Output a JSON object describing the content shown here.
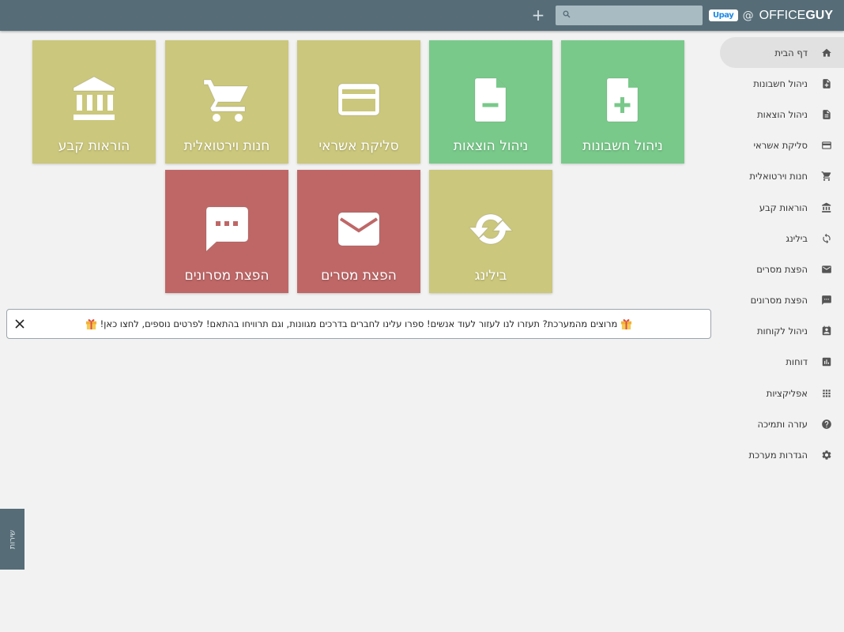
{
  "header": {
    "brand_logo_text": "Upay",
    "brand_at": "@",
    "brand_name_light": "OFFICE",
    "brand_name_bold": "GUY",
    "plus_label": "+",
    "search_placeholder": ""
  },
  "sidebar": {
    "items": [
      {
        "label": "דף הבית",
        "icon": "home-icon"
      },
      {
        "label": "ניהול חשבונות",
        "icon": "invoice-add-icon"
      },
      {
        "label": "ניהול הוצאות",
        "icon": "document-icon"
      },
      {
        "label": "סליקת אשראי",
        "icon": "credit-card-icon"
      },
      {
        "label": "חנות וירטואלית",
        "icon": "cart-icon"
      },
      {
        "label": "הוראות קבע",
        "icon": "bank-icon"
      },
      {
        "label": "בילינג",
        "icon": "sync-icon"
      },
      {
        "label": "הפצת מסרים",
        "icon": "mail-icon"
      },
      {
        "label": "הפצת מסרונים",
        "icon": "sms-icon"
      },
      {
        "label": "ניהול לקוחות",
        "icon": "contacts-icon"
      },
      {
        "label": "דוחות",
        "icon": "chart-icon"
      },
      {
        "label": "אפליקציות",
        "icon": "apps-icon"
      },
      {
        "label": "עזרה ותמיכה",
        "icon": "help-icon"
      },
      {
        "label": "הגדרות מערכת",
        "icon": "settings-icon"
      }
    ]
  },
  "tiles": [
    {
      "label": "ניהול חשבונות",
      "icon": "invoice-add-icon",
      "color": "#79c98a"
    },
    {
      "label": "ניהול הוצאות",
      "icon": "document-minus-icon",
      "color": "#79c98a"
    },
    {
      "label": "סליקת אשראי",
      "icon": "credit-card-icon",
      "color": "#cbc77c"
    },
    {
      "label": "חנות וירטואלית",
      "icon": "cart-icon",
      "color": "#cbc77c"
    },
    {
      "label": "הוראות קבע",
      "icon": "bank-icon",
      "color": "#cbc77c"
    },
    {
      "label": "בילינג",
      "icon": "sync-icon",
      "color": "#cbc77c"
    },
    {
      "label": "הפצת מסרים",
      "icon": "mail-icon",
      "color": "#bf6767"
    },
    {
      "label": "הפצת מסרונים",
      "icon": "sms-icon",
      "color": "#bf6767"
    }
  ],
  "banner": {
    "text": "מרוצים מהמערכת? תעזרו לנו לעזור לעוד אנשים! ספרו עלינו לחברים בדרכים מגוונות, וגם תרוויחו בהתאם! לפרטים נוספים, לחצו כאן!",
    "close_icon": "close-icon",
    "gift_icon": "gift-icon"
  },
  "side_tab": {
    "label": "שירות"
  },
  "colors": {
    "header": "#566d78",
    "green": "#79c98a",
    "olive": "#cbc77c",
    "red": "#bf6767"
  }
}
